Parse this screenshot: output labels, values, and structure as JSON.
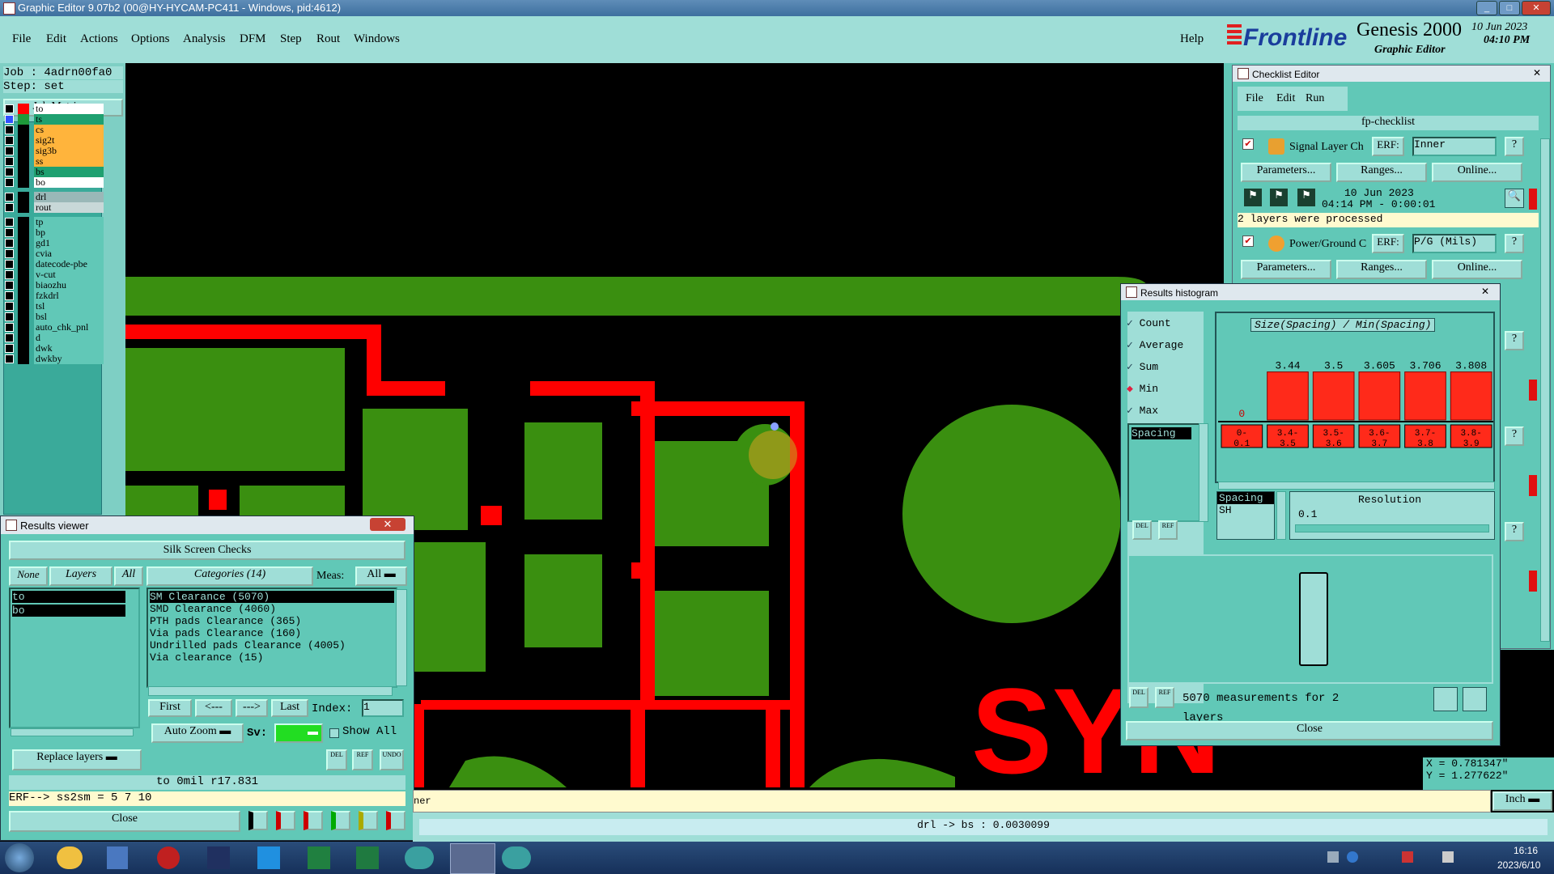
{
  "window": {
    "title": "Graphic Editor 9.07b2 (00@HY-HYCAM-PC411 - Windows, pid:4612)"
  },
  "menu": {
    "items": [
      "File",
      "Edit",
      "Actions",
      "Options",
      "Analysis",
      "DFM",
      "Step",
      "Rout",
      "Windows"
    ],
    "help": "Help"
  },
  "brand": {
    "logo": "Frontline",
    "product": "Genesis 2000",
    "subtitle": "Graphic Editor",
    "date": "10 Jun 2023",
    "time": "04:10 PM"
  },
  "job": {
    "job": "Job : 4adrn00fa0",
    "step": "Step: set",
    "matrix_btn": "Job Matrix ..."
  },
  "layers": [
    {
      "name": "to",
      "color": "#ff0000",
      "bg": "#ffffff"
    },
    {
      "name": "ts",
      "color": "#1e9a3a",
      "bg": "#1fa070",
      "sel": true
    },
    {
      "name": "cs",
      "color": "#000000",
      "bg": "#ffb43c"
    },
    {
      "name": "sig2t",
      "color": "#000000",
      "bg": "#ffb43c"
    },
    {
      "name": "sig3b",
      "color": "#000000",
      "bg": "#ffb43c"
    },
    {
      "name": "ss",
      "color": "#000000",
      "bg": "#ffb43c"
    },
    {
      "name": "bs",
      "color": "#000000",
      "bg": "#1fa070"
    },
    {
      "name": "bo",
      "color": "#000000",
      "bg": "#ffffff"
    },
    {
      "name": "drl",
      "color": "#000000",
      "bg": "#9ab8b8"
    },
    {
      "name": "rout",
      "color": "#000000",
      "bg": "#c8d8d8"
    },
    {
      "name": "tp",
      "color": "#000000",
      "bg": "#61c8b7"
    },
    {
      "name": "bp",
      "color": "#000000",
      "bg": "#61c8b7"
    },
    {
      "name": "gd1",
      "color": "#000000",
      "bg": "#61c8b7"
    },
    {
      "name": "cvia",
      "color": "#000000",
      "bg": "#61c8b7"
    },
    {
      "name": "datecode-pbe",
      "color": "#000000",
      "bg": "#61c8b7"
    },
    {
      "name": "v-cut",
      "color": "#000000",
      "bg": "#61c8b7"
    },
    {
      "name": "biaozhu",
      "color": "#000000",
      "bg": "#61c8b7"
    },
    {
      "name": "fzkdrl",
      "color": "#000000",
      "bg": "#61c8b7"
    },
    {
      "name": "tsl",
      "color": "#000000",
      "bg": "#61c8b7"
    },
    {
      "name": "bsl",
      "color": "#000000",
      "bg": "#61c8b7"
    },
    {
      "name": "auto_chk_pnl",
      "color": "#000000",
      "bg": "#61c8b7"
    },
    {
      "name": "d",
      "color": "#000000",
      "bg": "#61c8b7"
    },
    {
      "name": "dwk",
      "color": "#000000",
      "bg": "#61c8b7"
    },
    {
      "name": "dwkby",
      "color": "#000000",
      "bg": "#61c8b7"
    }
  ],
  "results_viewer": {
    "title": "Results viewer",
    "header": "Silk Screen Checks",
    "none": "None",
    "layers_label": "Layers",
    "all": "All",
    "categories_label": "Categories (14)",
    "meas_label": "Meas:",
    "meas_value": "All",
    "layer_items": [
      "to",
      "bo"
    ],
    "categories": [
      "SM Clearance (5070)",
      "SMD Clearance (4060)",
      "PTH pads Clearance (365)",
      "Via pads Clearance (160)",
      "Undrilled pads Clearance (4005)",
      "Via clearance (15)"
    ],
    "first": "First",
    "prev": "<---",
    "next": "--->",
    "last": "Last",
    "index_label": "Index:",
    "index_value": "1",
    "auto_zoom": "Auto Zoom",
    "sv_label": "Sv:",
    "show_all": "Show All",
    "replace_layers": "Replace layers",
    "del": "DEL",
    "ref": "REF",
    "undo": "UNDO",
    "status": "to 0mil  r17.831",
    "erf": "ERF--> ss2sm = 5 7 10",
    "close": "Close"
  },
  "checklist": {
    "title": "Checklist Editor",
    "menu": [
      "File",
      "Edit",
      "Run"
    ],
    "name": "fp-checklist",
    "action1": {
      "label": "Signal Layer Ch",
      "erf": "ERF:",
      "erf_value": "Inner",
      "date": "10 Jun 2023",
      "time": "04:14 PM - 0:00:01",
      "message": "2 layers were processed"
    },
    "action2": {
      "label": "Power/Ground C",
      "erf": "ERF:",
      "erf_value": "P/G (Mils)"
    },
    "parameters": "Parameters...",
    "ranges": "Ranges...",
    "online": "Online...",
    "help": "?"
  },
  "histogram": {
    "title": "Results histogram",
    "options": [
      "Count",
      "Average",
      "Sum",
      "Min",
      "Max"
    ],
    "selected_option": "Min",
    "list": [
      "Spacing"
    ],
    "chart_title": "Size(Spacing) / Min(Spacing)",
    "layer_col": "Spacing",
    "layer_sub": "SH",
    "resolution_label": "Resolution",
    "resolution_value": "0.1",
    "measurements": "5070 measurements for 2 layers",
    "close": "Close",
    "del": "DEL",
    "ref": "REF"
  },
  "chart_data": {
    "type": "bar",
    "title": "Size(Spacing) / Min(Spacing)",
    "categories": [
      "0-\n0.1",
      "3.4-\n3.5",
      "3.5-\n3.6",
      "3.6-\n3.7",
      "3.7-\n3.8",
      "3.8-\n3.9"
    ],
    "values": [
      0,
      3.44,
      3.5,
      3.605,
      3.706,
      3.808
    ],
    "value_labels": [
      "0",
      "3.44",
      "3.5",
      "3.605",
      "3.706",
      "3.808"
    ],
    "color": "#ff2a1a"
  },
  "coords": {
    "x": "X = 0.781347\"",
    "y": "Y = 1.277622\""
  },
  "status": {
    "measure": "drl -> bs : 0.0030099",
    "units": "Inch",
    "hint": "ner"
  },
  "taskbar": {
    "time": "16:16",
    "date": "2023/6/10"
  }
}
